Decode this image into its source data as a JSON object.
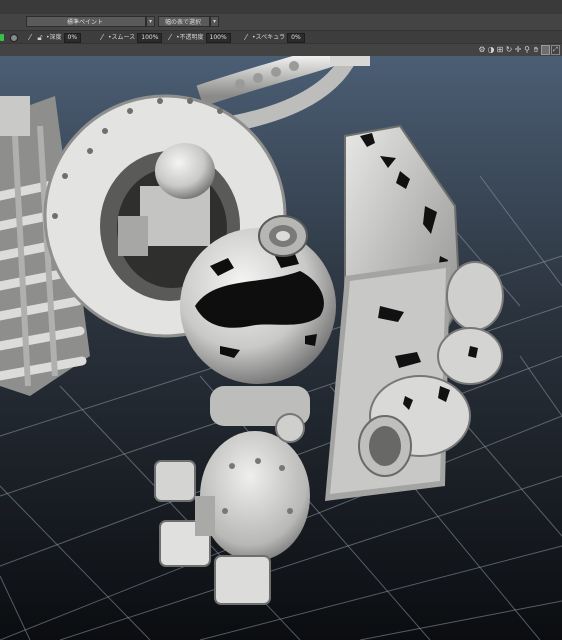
{
  "toolbar": {
    "preset_dropdown": {
      "value": "標準ペイント"
    },
    "mode_dropdown": {
      "value": "幅の表で選択"
    },
    "controls": [
      {
        "icon": "brush-icon",
        "label": "•深度",
        "value": "0%"
      },
      {
        "icon": "smooth-brush-icon",
        "label": "•スムース",
        "value": "100%"
      },
      {
        "icon": "opacity-icon",
        "label": "•不透明度",
        "value": "100%"
      },
      {
        "icon": "specular-icon",
        "label": "•スペキュラ",
        "value": "0%"
      }
    ],
    "viewport_icons": [
      "gear-icon",
      "camera-icon",
      "grid-icon",
      "rotate-icon",
      "move-icon",
      "search-icon",
      "pan-icon",
      "frame-icon",
      "maximize-icon"
    ]
  },
  "colors": {
    "accent_green": "#39c04a",
    "viewport_top": "#4a5d73",
    "viewport_bottom": "#0b0d10",
    "grid": "#9aa3ad",
    "model": "#d0d0cf"
  }
}
